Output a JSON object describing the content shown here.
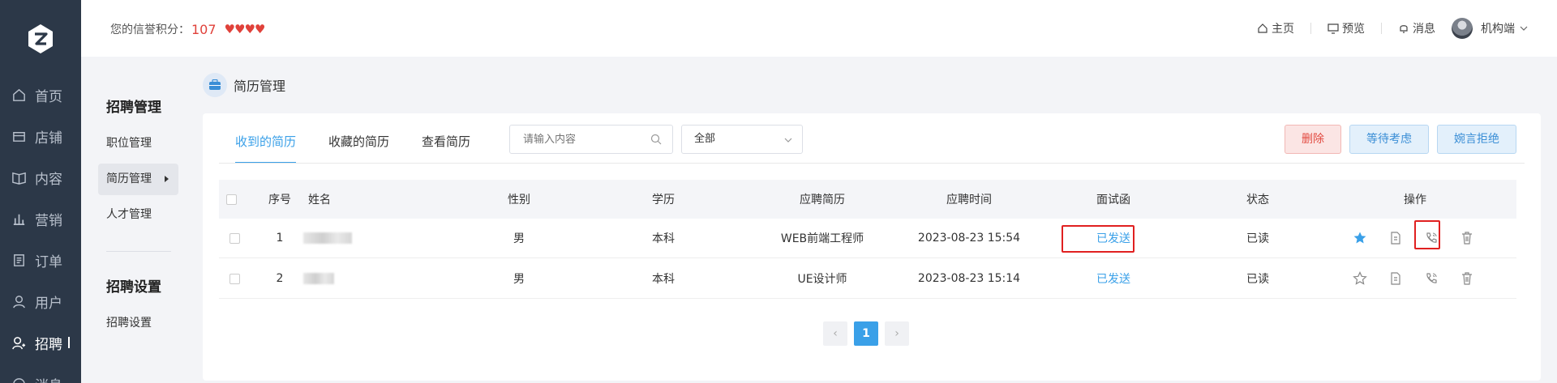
{
  "rail": {
    "items": [
      {
        "label": "首页"
      },
      {
        "label": "店铺"
      },
      {
        "label": "内容"
      },
      {
        "label": "营销"
      },
      {
        "label": "订单"
      },
      {
        "label": "用户"
      },
      {
        "label": "招聘"
      },
      {
        "label": "消息"
      }
    ],
    "active_index": 6
  },
  "header": {
    "credit_label": "您的信誉积分：",
    "credit_score": "107",
    "hearts": "♥♥♥♥",
    "nav": [
      {
        "label": "主页",
        "icon": "home-icon"
      },
      {
        "label": "预览",
        "icon": "monitor-icon"
      },
      {
        "label": "消息",
        "icon": "bell-icon"
      }
    ],
    "user_name": "机构端"
  },
  "subnav": {
    "group1": "招聘管理",
    "group1_items": [
      {
        "label": "职位管理"
      },
      {
        "label": "简历管理"
      },
      {
        "label": "人才管理"
      }
    ],
    "group2": "招聘设置",
    "group2_items": [
      {
        "label": "招聘设置"
      }
    ]
  },
  "page": {
    "title": "简历管理"
  },
  "tabs": [
    {
      "label": "收到的简历",
      "active": true
    },
    {
      "label": "收藏的简历",
      "active": false
    },
    {
      "label": "查看简历",
      "active": false
    }
  ],
  "filters": {
    "search_placeholder": "请输入内容",
    "select_value": "全部"
  },
  "buttons": {
    "delete": "删除",
    "wait": "等待考虑",
    "reject": "婉言拒绝"
  },
  "table": {
    "headers": {
      "index": "序号",
      "name": "姓名",
      "gender": "性别",
      "education": "学历",
      "resume": "应聘简历",
      "time": "应聘时间",
      "invite": "面试函",
      "status": "状态",
      "actions": "操作"
    },
    "rows": [
      {
        "index": "1",
        "gender": "男",
        "education": "本科",
        "resume": "WEB前端工程师",
        "time": "2023-08-23 15:54",
        "invite": "已发送",
        "status": "已读",
        "starred": true
      },
      {
        "index": "2",
        "gender": "男",
        "education": "本科",
        "resume": "UE设计师",
        "time": "2023-08-23 15:14",
        "invite": "已发送",
        "status": "已读",
        "starred": false
      }
    ]
  },
  "pagination": {
    "current": "1",
    "prev": "‹",
    "next": "›"
  },
  "colors": {
    "accent": "#3aa0e8",
    "rail_bg": "#2c3848",
    "danger": "#e24a40",
    "highlight_box": "#e02020"
  }
}
